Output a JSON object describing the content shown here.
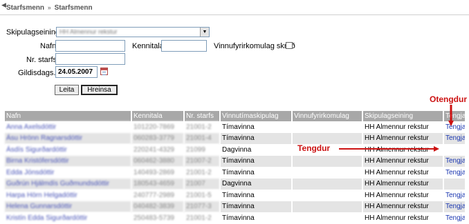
{
  "breadcrumb": {
    "item1": "Starfsmenn",
    "separator": "»",
    "item2": "Starfsmenn"
  },
  "form": {
    "skipulagseining_label": "Skipulagseining",
    "skipulagseining_value": "HH Almennur rekstur",
    "nafn_label": "Nafn",
    "kennitala_label": "Kennitala",
    "vinnufyrirkomulag_label": "Vinnufyrirkomulag skráð",
    "nr_starfs_label": "Nr. starfs",
    "gildisdags_label": "Gildisdags.",
    "gildisdags_value": "24.05.2007",
    "leita_label": "Leita",
    "hreinsa_label": "Hreinsa"
  },
  "table": {
    "headers": [
      "Nafn",
      "Kennitala",
      "Nr. starfs",
      "Vinnutímaskipulag",
      "Vinnufyrirkomulag",
      "Skipulagseining",
      "Tengja"
    ],
    "rows": [
      {
        "nafn": "Anna Axelsdóttir",
        "kennitala": "101220-7869",
        "nr": "21001-2",
        "vinnutimi": "Tímavinna",
        "fyrirkomulag": "",
        "eining": "HH Almennur rekstur",
        "tengja": "Tengja"
      },
      {
        "nafn": "Ásu Hrönn Ragnarsdóttir",
        "kennitala": "060283-3779",
        "nr": "21001-4",
        "vinnutimi": "Tímavinna",
        "fyrirkomulag": "",
        "eining": "HH Almennur rekstur",
        "tengja": "Tengja"
      },
      {
        "nafn": "Ásdís Sigurðardóttir",
        "kennitala": "220241-4329",
        "nr": "21099",
        "vinnutimi": "Dagvinna",
        "fyrirkomulag": "",
        "eining": "HH Almennur rekstur",
        "tengja": ""
      },
      {
        "nafn": "Birna Kristófersdóttir",
        "kennitala": "060462-3880",
        "nr": "21007-2",
        "vinnutimi": "Tímavinna",
        "fyrirkomulag": "",
        "eining": "HH Almennur rekstur",
        "tengja": "Tengja"
      },
      {
        "nafn": "Edda Jónsdóttir",
        "kennitala": "140493-2869",
        "nr": "21001-2",
        "vinnutimi": "Tímavinna",
        "fyrirkomulag": "",
        "eining": "HH Almennur rekstur",
        "tengja": "Tengja"
      },
      {
        "nafn": "Guðrún Hjálmdís Guðmundsdóttir",
        "kennitala": "180543-4659",
        "nr": "21007",
        "vinnutimi": "Dagvinna",
        "fyrirkomulag": "",
        "eining": "HH Almennur rekstur",
        "tengja": ""
      },
      {
        "nafn": "Harpa Hörn Helgadóttir",
        "kennitala": "240777-2989",
        "nr": "21001-5",
        "vinnutimi": "Tímavinna",
        "fyrirkomulag": "",
        "eining": "HH Almennur rekstur",
        "tengja": "Tengja"
      },
      {
        "nafn": "Helena Gunnarsdóttir",
        "kennitala": "040482-3839",
        "nr": "21077-3",
        "vinnutimi": "Tímavinna",
        "fyrirkomulag": "",
        "eining": "HH Almennur rekstur",
        "tengja": "Tengja"
      },
      {
        "nafn": "Kristín Edda Sigurðardóttir",
        "kennitala": "250483-5739",
        "nr": "21001-2",
        "vinnutimi": "Tímavinna",
        "fyrirkomulag": "",
        "eining": "HH Almennur rekstur",
        "tengja": "Tengja"
      }
    ]
  },
  "annotations": {
    "otengdur": "Otengdur",
    "tengdur": "Tengdur",
    "color": "#cc1111"
  },
  "icons": {
    "back": "back-chevron-icon",
    "dropdown": "dropdown-arrow-icon",
    "calendar": "calendar-icon"
  }
}
